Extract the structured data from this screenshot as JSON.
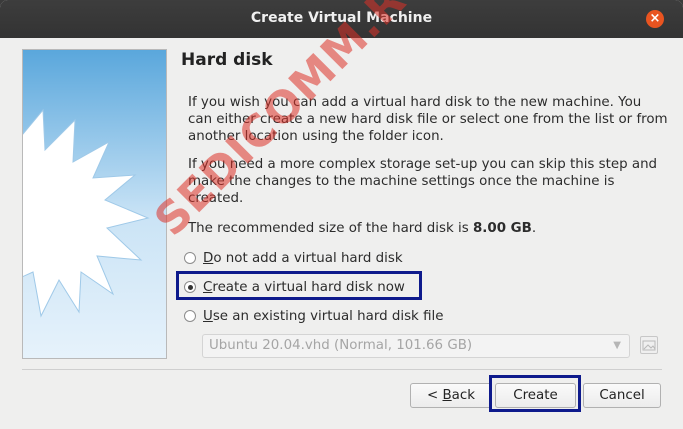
{
  "window": {
    "title": "Create Virtual Machine",
    "close_glyph": "×"
  },
  "page": {
    "heading": "Hard disk",
    "paragraph_1": "If you wish you can add a virtual hard disk to the new machine. You can either create a new hard disk file or select one from the list or from another location using the folder icon.",
    "paragraph_2": "If you need a more complex storage set-up you can skip this step and make the changes to the machine settings once the machine is created.",
    "recommended_prefix": "The recommended size of the hard disk is ",
    "recommended_size": "8.00 GB",
    "recommended_suffix": "."
  },
  "options": {
    "do_not_add_prefix": "D",
    "do_not_add_rest": "o not add a virtual hard disk",
    "create_now_prefix": "C",
    "create_now_rest": "reate a virtual hard disk now",
    "use_existing_prefix": "U",
    "use_existing_rest": "se an existing virtual hard disk file",
    "selected": "create_now"
  },
  "disk_select": {
    "value": "Ubuntu 20.04.vhd (Normal, 101.66 GB)",
    "enabled": false
  },
  "buttons": {
    "back_prefix": "< ",
    "back_underlined": "B",
    "back_rest": "ack",
    "create": "Create",
    "cancel": "Cancel"
  },
  "watermark": "SEDICOMM.RU",
  "colors": {
    "titlebar": "#363636",
    "close": "#e95420",
    "highlight_border": "#0e1a8c",
    "watermark": "#dc3228"
  }
}
